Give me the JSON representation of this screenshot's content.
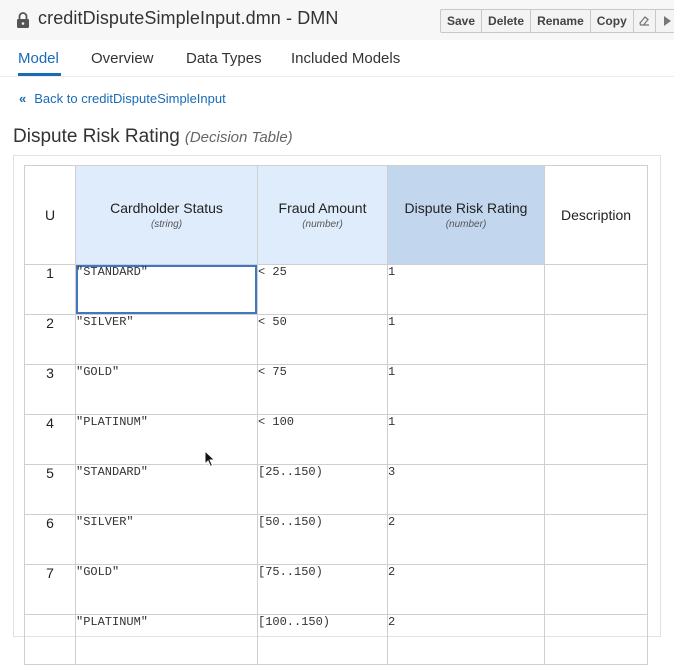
{
  "window": {
    "title": "creditDisputeSimpleInput.dmn - DMN",
    "buttons": [
      "Save",
      "Delete",
      "Rename",
      "Copy"
    ],
    "icons": [
      "eraser-icon",
      "play-icon"
    ]
  },
  "tabs": [
    {
      "label": "Model",
      "active": true
    },
    {
      "label": "Overview",
      "active": false
    },
    {
      "label": "Data Types",
      "active": false
    },
    {
      "label": "Included Models",
      "active": false
    }
  ],
  "back_link": {
    "arrow": "«",
    "label": "Back to creditDisputeSimpleInput"
  },
  "decision": {
    "name": "Dispute Risk Rating",
    "kind": "(Decision Table)"
  },
  "table": {
    "hit_policy": "U",
    "columns": [
      {
        "name": "Cardholder Status",
        "type": "(string)",
        "role": "input"
      },
      {
        "name": "Fraud Amount",
        "type": "(number)",
        "role": "input"
      },
      {
        "name": "Dispute Risk Rating",
        "type": "(number)",
        "role": "output"
      },
      {
        "name": "Description",
        "type": "",
        "role": "annotation"
      }
    ],
    "rows": [
      {
        "n": "1",
        "cells": [
          "\"STANDARD\"",
          "< 25",
          "1",
          ""
        ]
      },
      {
        "n": "2",
        "cells": [
          "\"SILVER\"",
          "< 50",
          "1",
          ""
        ]
      },
      {
        "n": "3",
        "cells": [
          "\"GOLD\"",
          "< 75",
          "1",
          ""
        ]
      },
      {
        "n": "4",
        "cells": [
          "\"PLATINUM\"",
          "< 100",
          "1",
          ""
        ]
      },
      {
        "n": "5",
        "cells": [
          "\"STANDARD\"",
          "[25..150)",
          "3",
          ""
        ]
      },
      {
        "n": "6",
        "cells": [
          "\"SILVER\"",
          "[50..150)",
          "2",
          ""
        ]
      },
      {
        "n": "7",
        "cells": [
          "\"GOLD\"",
          "[75..150)",
          "2",
          ""
        ]
      },
      {
        "n": "",
        "cells": [
          "\"PLATINUM\"",
          "[100..150)",
          "2",
          ""
        ]
      }
    ],
    "selected_cell": {
      "row": 0,
      "col": 0
    }
  },
  "colors": {
    "accent": "#1a6bb5",
    "input_header": "#dfecfb",
    "output_header": "#c2d7ee"
  }
}
